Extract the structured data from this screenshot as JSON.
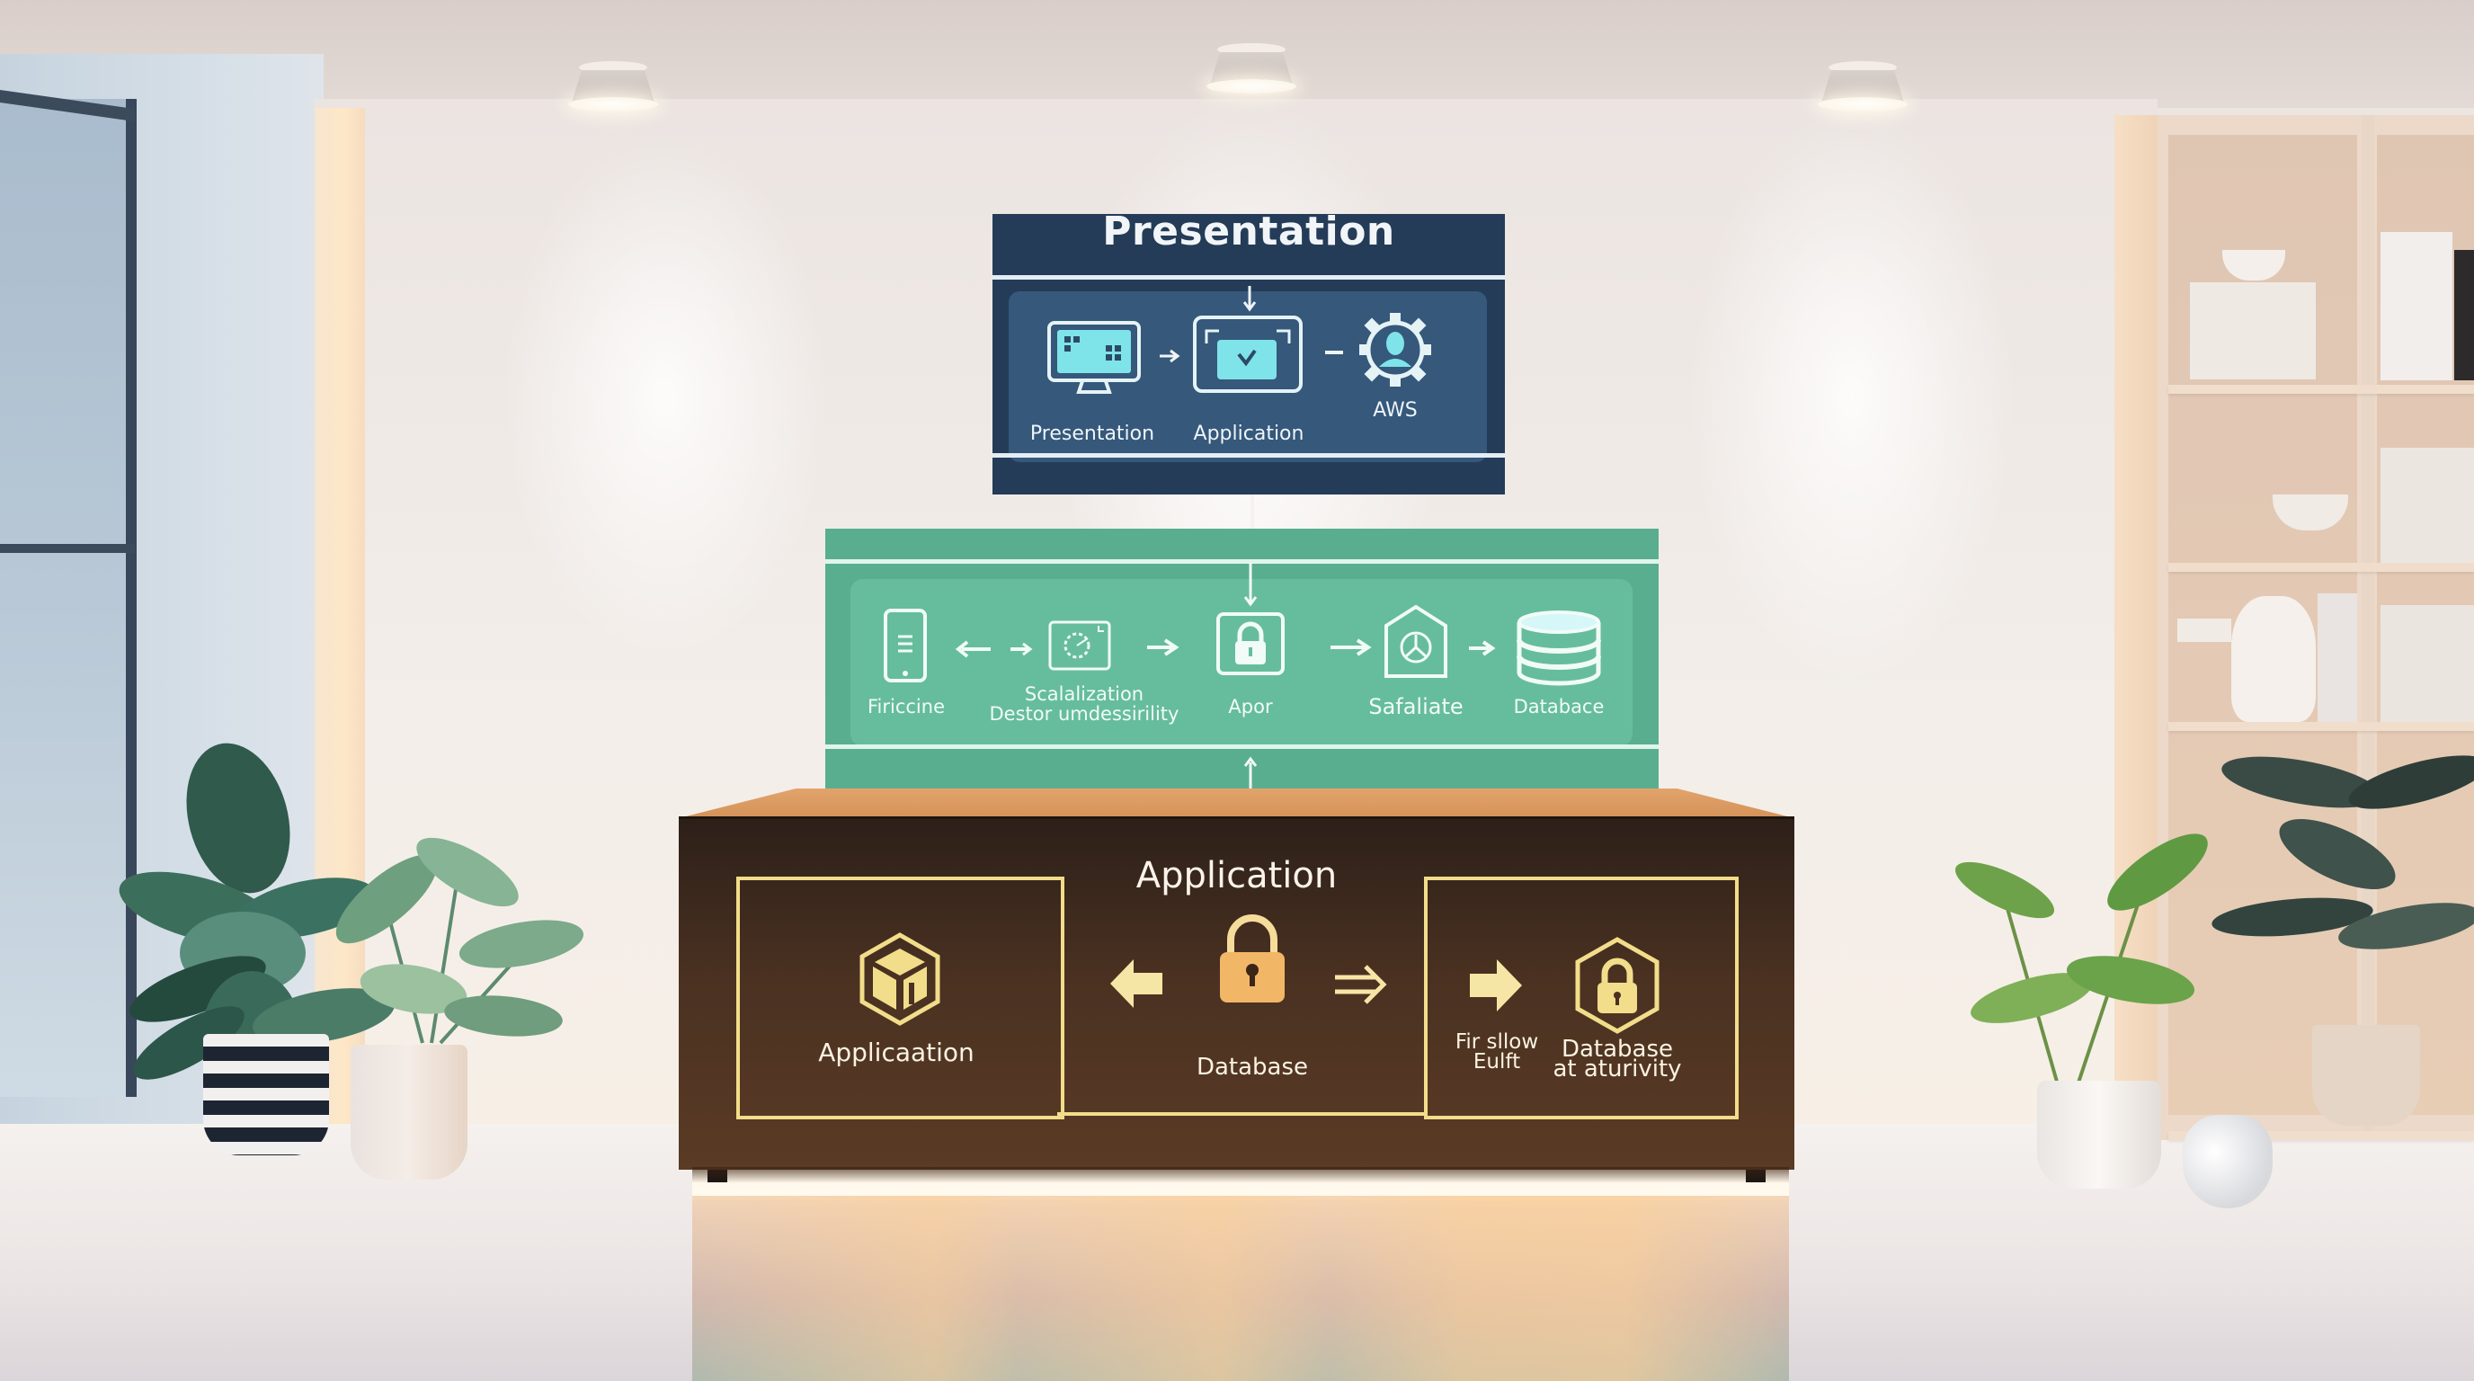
{
  "scene": {
    "description": "Office room with a three-tier architecture diagram display",
    "colors": {
      "presentation_tier": "#243c58",
      "presentation_inner": "#35587b",
      "icon_cyan": "#7fe3ea",
      "services_tier": "#5aae90",
      "services_inner": "#66bd9e",
      "cabinet": "#4a3121",
      "cabinet_accent": "#f2dd8a",
      "lock_orange": "#f2b766"
    }
  },
  "tiers": {
    "presentation": {
      "title": "Presentation",
      "items": [
        {
          "icon": "monitor-icon",
          "label": "Presentation"
        },
        {
          "icon": "app-window-check-icon",
          "label": "Application"
        },
        {
          "icon": "gear-user-icon",
          "label": "AWS"
        }
      ]
    },
    "services": {
      "items": [
        {
          "icon": "smartphone-icon",
          "label": "Firiccine"
        },
        {
          "icon": "clock-window-icon",
          "label_line1": "Scalalization",
          "label_line2": "Destor umdessirility"
        },
        {
          "icon": "lock-icon",
          "label": "Apor"
        },
        {
          "icon": "shield-house-icon",
          "label": "Safaliate"
        },
        {
          "icon": "database-icon",
          "label": "Databace"
        }
      ]
    },
    "application": {
      "title": "Application",
      "left": {
        "icon": "cube-hexagon-icon",
        "label": "Applicaation"
      },
      "center": {
        "icon": "padlock-icon",
        "label": "Database"
      },
      "right": {
        "arrow_label_line1": "Fir sllow",
        "arrow_label_line2": "Eulft",
        "icon": "hexagon-lock-icon",
        "label_line1": "Database",
        "label_line2": "at aturivity"
      }
    }
  }
}
